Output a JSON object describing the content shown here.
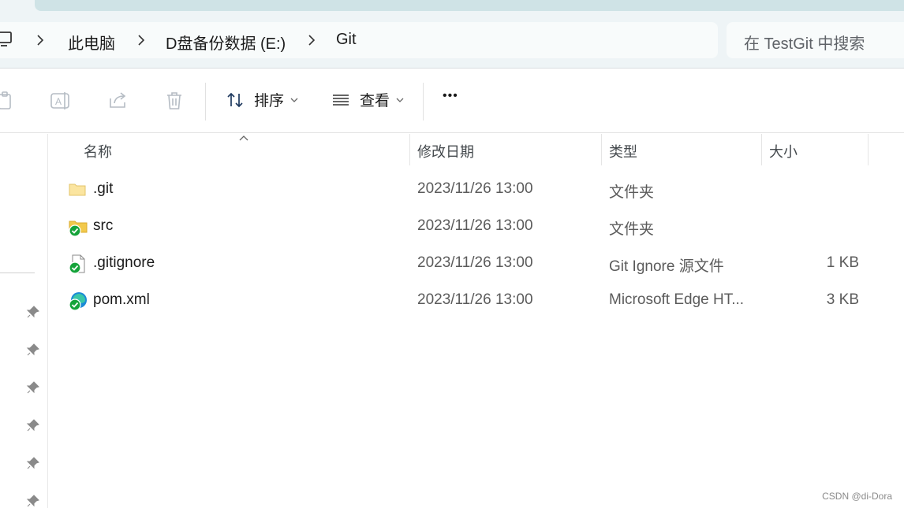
{
  "address_bar": {
    "crumbs": [
      "此电脑",
      "D盘备份数据 (E:)",
      "Git"
    ]
  },
  "search": {
    "placeholder": "在 TestGit 中搜索"
  },
  "toolbar": {
    "sort_label": "排序",
    "view_label": "查看",
    "more_label": "•••"
  },
  "columns": {
    "name": "名称",
    "modified": "修改日期",
    "type": "类型",
    "size": "大小"
  },
  "files": [
    {
      "name": ".git",
      "modified": "2023/11/26 13:00",
      "type": "文件夹",
      "size": "",
      "icon": "folder-icon"
    },
    {
      "name": "src",
      "modified": "2023/11/26 13:00",
      "type": "文件夹",
      "size": "",
      "icon": "folder-synced-icon"
    },
    {
      "name": ".gitignore",
      "modified": "2023/11/26 13:00",
      "type": "Git Ignore 源文件",
      "size": "1 KB",
      "icon": "file-synced-icon"
    },
    {
      "name": "pom.xml",
      "modified": "2023/11/26 13:00",
      "type": "Microsoft Edge HT...",
      "size": "3 KB",
      "icon": "edge-file-synced-icon"
    }
  ],
  "watermark": "CSDN @di-Dora",
  "colors": {
    "accent": "#0067c0",
    "synced_green": "#15a33a",
    "folder_yellow": "#f2c94c"
  }
}
